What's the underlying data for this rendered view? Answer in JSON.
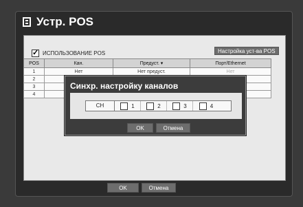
{
  "window": {
    "title": "Устр. POS"
  },
  "use_pos": {
    "label": "ИСПОЛЬЗОВАНИЕ POS",
    "checked": true
  },
  "setup_button": "Настройка уст-ва POS",
  "table": {
    "headers": [
      "POS",
      "Кан.",
      "Предуст. ▾",
      "Порт/Ethernet"
    ],
    "rows": [
      [
        "1",
        "Нет",
        "Нет предуст.",
        "Нет"
      ],
      [
        "2",
        "",
        "",
        ""
      ],
      [
        "3",
        "",
        "",
        ""
      ],
      [
        "4",
        "",
        "",
        ""
      ]
    ]
  },
  "footer": {
    "ok": "OK",
    "cancel": "Отмена"
  },
  "dialog": {
    "title": "Синхр. настройку каналов",
    "channel_label": "CH",
    "channels": [
      "1",
      "2",
      "3",
      "4"
    ],
    "ok": "OK",
    "cancel": "Отмена"
  }
}
